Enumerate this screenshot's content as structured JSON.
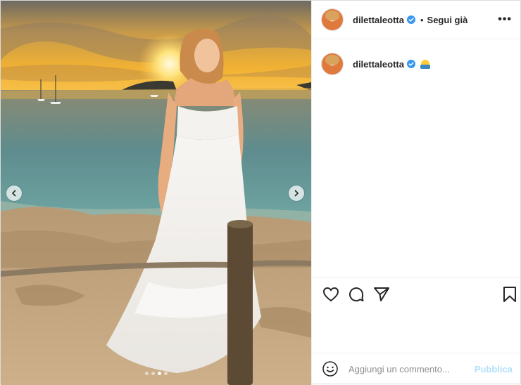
{
  "post": {
    "username": "dilettaleotta",
    "follow_label": "Segui già",
    "separator": "•",
    "more_label": "•••",
    "caption_username": "dilettaleotta",
    "carousel": {
      "total": 4,
      "active_index": 2
    }
  },
  "icons": {
    "verified": "verified-badge-icon",
    "like": "heart-icon",
    "comment": "comment-icon",
    "share": "paper-plane-icon",
    "save": "bookmark-icon",
    "emoji": "smiley-icon",
    "caption_emoji": "face-with-hands-emoji"
  },
  "comment_box": {
    "placeholder": "Aggiungi un commento...",
    "publish_label": "Pubblica"
  },
  "colors": {
    "verified": "#3897f0",
    "publish_disabled": "#b2dffc",
    "text": "#262626"
  }
}
